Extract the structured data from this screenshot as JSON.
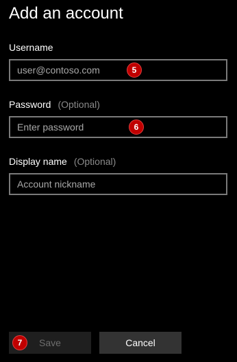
{
  "page": {
    "title": "Add an account"
  },
  "username": {
    "label": "Username",
    "placeholder": "user@contoso.com",
    "badge": "5"
  },
  "password": {
    "label": "Password",
    "optional": "(Optional)",
    "placeholder": "Enter password",
    "badge": "6"
  },
  "display_name": {
    "label": "Display name",
    "optional": "(Optional)",
    "placeholder": "Account nickname"
  },
  "actions": {
    "save_label": "Save",
    "save_enabled": false,
    "save_badge": "7",
    "cancel_label": "Cancel"
  },
  "colors": {
    "background": "#000000",
    "input_border": "#7a7a7a",
    "badge": "#c00000",
    "save_bg_disabled": "#1f1f1f",
    "cancel_bg": "#333333"
  }
}
